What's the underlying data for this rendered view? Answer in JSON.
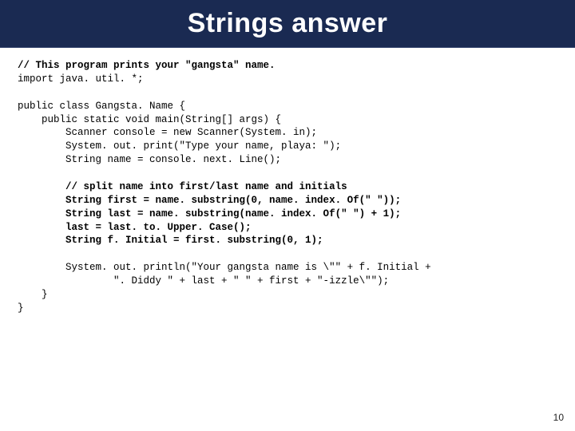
{
  "slide": {
    "title": "Strings answer",
    "page_number": "10"
  },
  "code": {
    "c01": "// This program prints your \"gangsta\" name.",
    "c02": "import java. util. *;",
    "c03": "",
    "c04": "public class Gangsta. Name {",
    "c05": "    public static void main(String[] args) {",
    "c06": "        Scanner console = new Scanner(System. in);",
    "c07": "        System. out. print(\"Type your name, playa: \");",
    "c08": "        String name = console. next. Line();",
    "c09": "",
    "c10": "        // split name into first/last name and initials",
    "c11": "        String first = name. substring(0, name. index. Of(\" \"));",
    "c12": "        String last = name. substring(name. index. Of(\" \") + 1);",
    "c13": "        last = last. to. Upper. Case();",
    "c14": "        String f. Initial = first. substring(0, 1);",
    "c15": "",
    "c16": "        System. out. println(\"Your gangsta name is \\\"\" + f. Initial +",
    "c17": "                \". Diddy \" + last + \" \" + first + \"-izzle\\\"\");",
    "c18": "    }",
    "c19": "}"
  }
}
